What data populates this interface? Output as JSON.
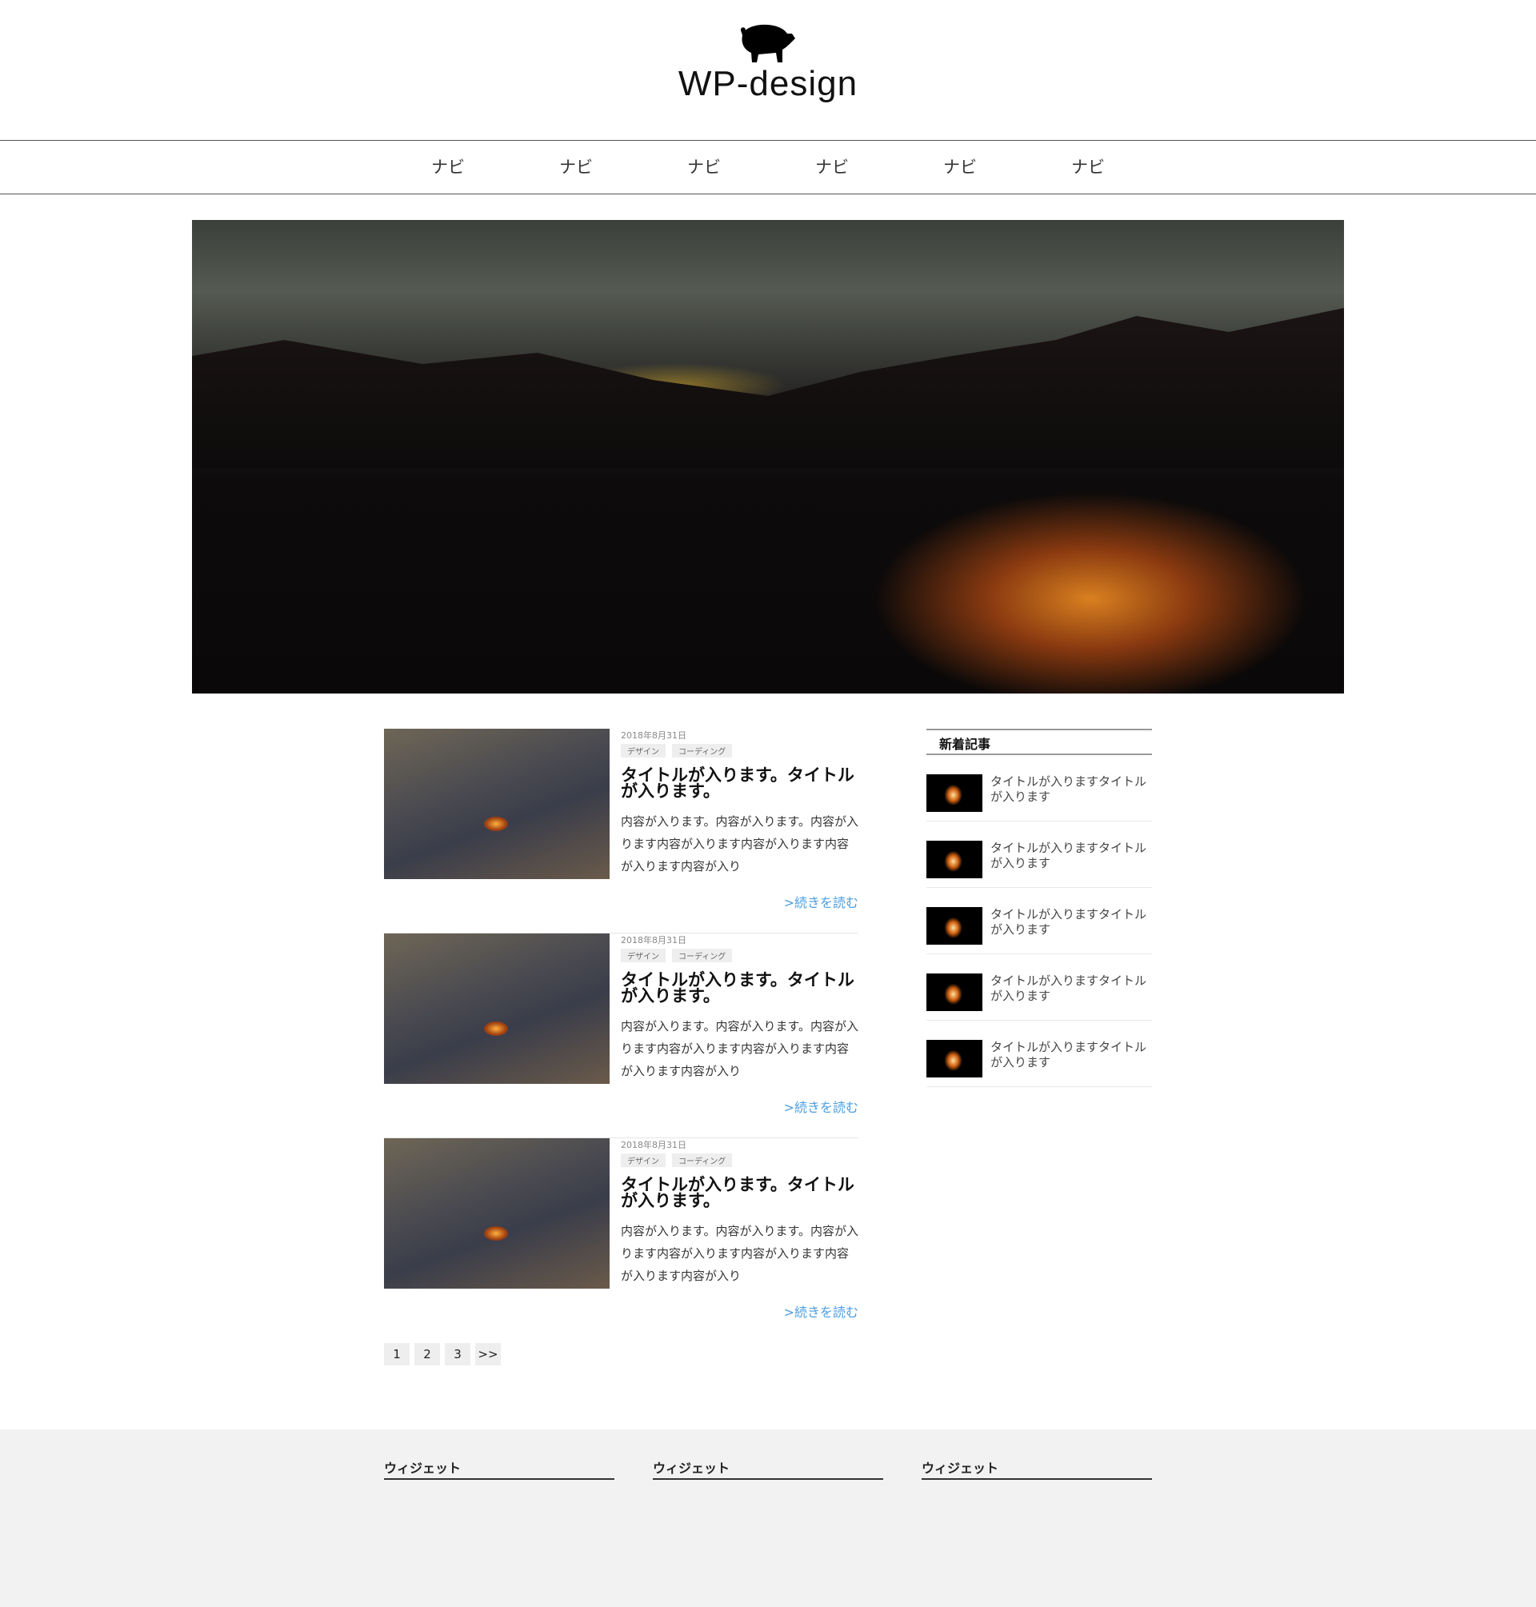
{
  "site": {
    "title": "WP-design",
    "logo_icon": "pig-icon"
  },
  "nav": [
    "ナビ",
    "ナビ",
    "ナビ",
    "ナビ",
    "ナビ",
    "ナビ"
  ],
  "posts": [
    {
      "date": "2018年8月31日",
      "tags": [
        "デザイン",
        "コーディング"
      ],
      "title": "タイトルが入ります。タイトルが入ります。",
      "excerpt": "内容が入ります。内容が入ります。内容が入ります内容が入ります内容が入ります内容が入ります内容が入り",
      "more": ">続きを読む"
    },
    {
      "date": "2018年8月31日",
      "tags": [
        "デザイン",
        "コーディング"
      ],
      "title": "タイトルが入ります。タイトルが入ります。",
      "excerpt": "内容が入ります。内容が入ります。内容が入ります内容が入ります内容が入ります内容が入ります内容が入り",
      "more": ">続きを読む"
    },
    {
      "date": "2018年8月31日",
      "tags": [
        "デザイン",
        "コーディング"
      ],
      "title": "タイトルが入ります。タイトルが入ります。",
      "excerpt": "内容が入ります。内容が入ります。内容が入ります内容が入ります内容が入ります内容が入ります内容が入り",
      "more": ">続きを読む"
    }
  ],
  "pagination": [
    "1",
    "2",
    "3",
    ">>"
  ],
  "sidebar": {
    "title": "新着記事",
    "items": [
      "タイトルが入りますタイトルが入ります",
      "タイトルが入りますタイトルが入ります",
      "タイトルが入りますタイトルが入ります",
      "タイトルが入りますタイトルが入ります",
      "タイトルが入りますタイトルが入ります"
    ]
  },
  "footer": {
    "widgets": [
      "ウィジェット",
      "ウィジェット",
      "ウィジェット"
    ]
  },
  "colors": {
    "link": "#4a9ee0",
    "footer_bg": "#f2f2f2"
  }
}
